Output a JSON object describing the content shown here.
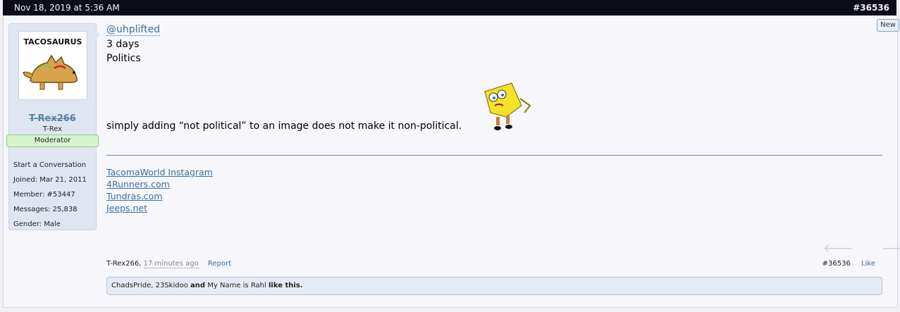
{
  "topbar": {
    "date": "Nov 18, 2019 at 5:36 AM",
    "post_number": "#36536"
  },
  "new_badge": "New",
  "author": {
    "avatar_title": "TACOSAURUS",
    "username": "T-Rex266",
    "title": "T-Rex",
    "badge": "Moderator",
    "stats": [
      "Start a Conversation",
      "Joined: Mar 21, 2011",
      "Member: #53447",
      "Messages: 25,838",
      "Gender: Male"
    ]
  },
  "message": {
    "mention": "@uhplifted",
    "line1": "3 days",
    "line2": "Politics",
    "quote": "simply adding “not political” to an image does not make it non-political."
  },
  "signature": {
    "links": [
      "TacomaWorld Instagram",
      "4Runners.com",
      "Tundras.com",
      "Jeeps.net"
    ]
  },
  "footer": {
    "author": "T-Rex266,",
    "time": "17 minutes ago",
    "report": "Report",
    "post_number": "#36536",
    "like": "Like"
  },
  "likes": {
    "users": "ChadsPride, 23Skidoo",
    "and": "and",
    "last_user": "My Name is Rahl",
    "suffix": "like this."
  },
  "icons": {
    "prev": "arrow-left-icon",
    "next": "arrow-right-icon"
  }
}
